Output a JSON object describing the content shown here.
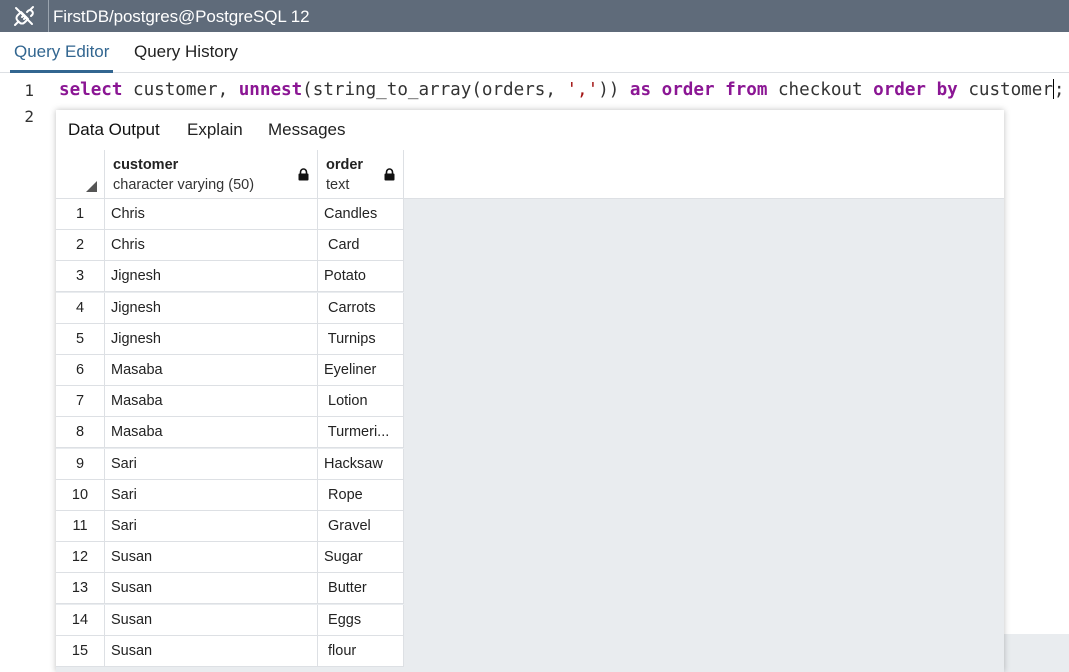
{
  "window": {
    "title": "FirstDB/postgres@PostgreSQL 12",
    "icon": "plug-icon"
  },
  "main_tabs": [
    {
      "label": "Query Editor",
      "active": true
    },
    {
      "label": "Query History",
      "active": false
    }
  ],
  "editor": {
    "line_numbers": [
      "1",
      "2"
    ],
    "code": {
      "t1": "select",
      "t2": " customer, ",
      "t3": "unnest",
      "t4": "(string_to_array(orders, ",
      "t5": "','",
      "t6": ")) ",
      "t7": "as",
      "t8": " ",
      "t9": "order",
      "t10": " ",
      "t11": "from",
      "t12": " checkout ",
      "t13": "order",
      "t14": " ",
      "t15": "by",
      "t16": " customer",
      "t17": ";"
    }
  },
  "results_tabs": [
    {
      "label": "Data Output",
      "active": true
    },
    {
      "label": "Explain",
      "active": false
    },
    {
      "label": "Messages",
      "active": false
    }
  ],
  "grid": {
    "columns": [
      {
        "name": "customer",
        "type": "character varying (50)",
        "icon": "lock-icon"
      },
      {
        "name": "order",
        "type": "text",
        "icon": "lock-icon"
      }
    ],
    "rows": [
      {
        "n": "1",
        "customer": "Chris",
        "order": "Candles"
      },
      {
        "n": "2",
        "customer": "Chris",
        "order": " Card"
      },
      {
        "n": "3",
        "customer": "Jignesh",
        "order": "Potato"
      },
      {
        "n": "4",
        "customer": "Jignesh",
        "order": " Carrots"
      },
      {
        "n": "5",
        "customer": "Jignesh",
        "order": " Turnips"
      },
      {
        "n": "6",
        "customer": "Masaba",
        "order": "Eyeliner"
      },
      {
        "n": "7",
        "customer": "Masaba",
        "order": " Lotion"
      },
      {
        "n": "8",
        "customer": "Masaba",
        "order": " Turmeri..."
      },
      {
        "n": "9",
        "customer": "Sari",
        "order": "Hacksaw"
      },
      {
        "n": "10",
        "customer": "Sari",
        "order": " Rope"
      },
      {
        "n": "11",
        "customer": "Sari",
        "order": " Gravel"
      },
      {
        "n": "12",
        "customer": "Susan",
        "order": "Sugar"
      },
      {
        "n": "13",
        "customer": "Susan",
        "order": " Butter"
      },
      {
        "n": "14",
        "customer": "Susan",
        "order": " Eggs"
      },
      {
        "n": "15",
        "customer": "Susan",
        "order": " flour"
      }
    ]
  },
  "colors": {
    "titlebar": "#5f6b7a",
    "accent": "#326690",
    "keyword": "#8b1694",
    "string": "#a31515",
    "grid_bg": "#e9ecef"
  }
}
